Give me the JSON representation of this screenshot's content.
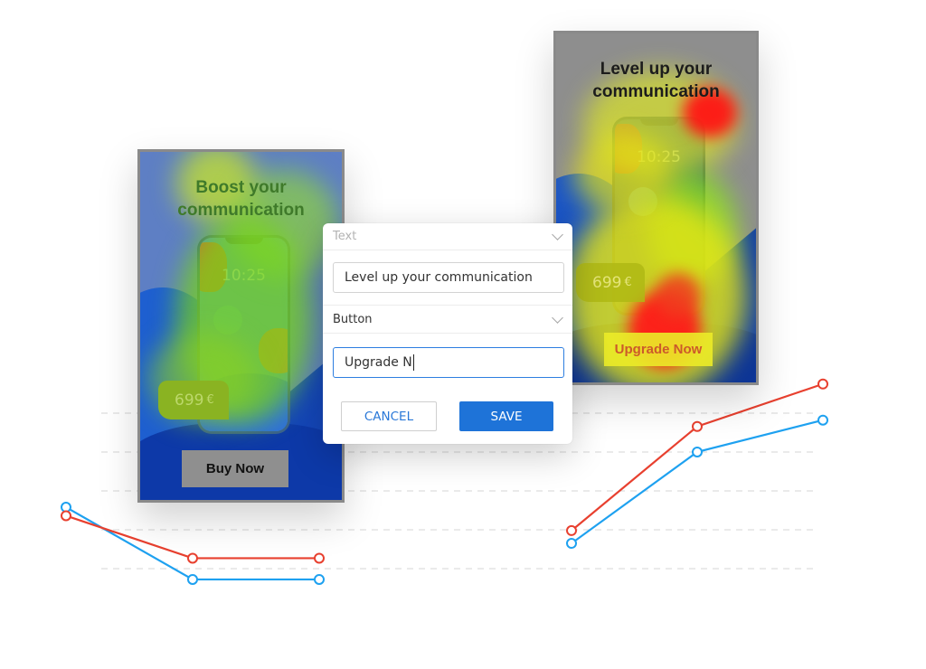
{
  "left_ad": {
    "headline_line1": "Boost your",
    "headline_line2": "communication",
    "phone_time": "10:25",
    "price": "699",
    "currency": "€",
    "cta_label": "Buy Now"
  },
  "right_ad": {
    "headline_line1": "Level up your",
    "headline_line2": "communication",
    "phone_time": "10:25",
    "price": "699",
    "currency": "€",
    "cta_label": "Upgrade Now"
  },
  "edit_dialog": {
    "text_section_label": "Text",
    "text_field_value": "Level up your communication",
    "button_section_label": "Button",
    "button_field_value": "Upgrade N",
    "cancel_label": "CANCEL",
    "save_label": "SAVE"
  },
  "colors": {
    "series_a": "#e8402f",
    "series_b": "#1ea1f0",
    "accent_blue": "#1e73d8",
    "gridline": "#dddddd"
  },
  "chart_data": [
    {
      "type": "line",
      "title": "",
      "xlabel": "",
      "ylabel": "",
      "grid": true,
      "gridlines": 5,
      "x": [
        1,
        2,
        3
      ],
      "series": [
        {
          "name": "red",
          "values": [
            1.65,
            0.65,
            0.65
          ]
        },
        {
          "name": "blue",
          "values": [
            1.85,
            0.15,
            0.15
          ]
        }
      ],
      "ylim": [
        0,
        4
      ]
    },
    {
      "type": "line",
      "title": "",
      "xlabel": "",
      "ylabel": "",
      "grid": true,
      "x": [
        1,
        2,
        3
      ],
      "series": [
        {
          "name": "red",
          "values": [
            1.3,
            3.75,
            4.75
          ]
        },
        {
          "name": "blue",
          "values": [
            1.0,
            3.15,
            3.9
          ]
        }
      ],
      "ylim": [
        0,
        4
      ]
    }
  ]
}
